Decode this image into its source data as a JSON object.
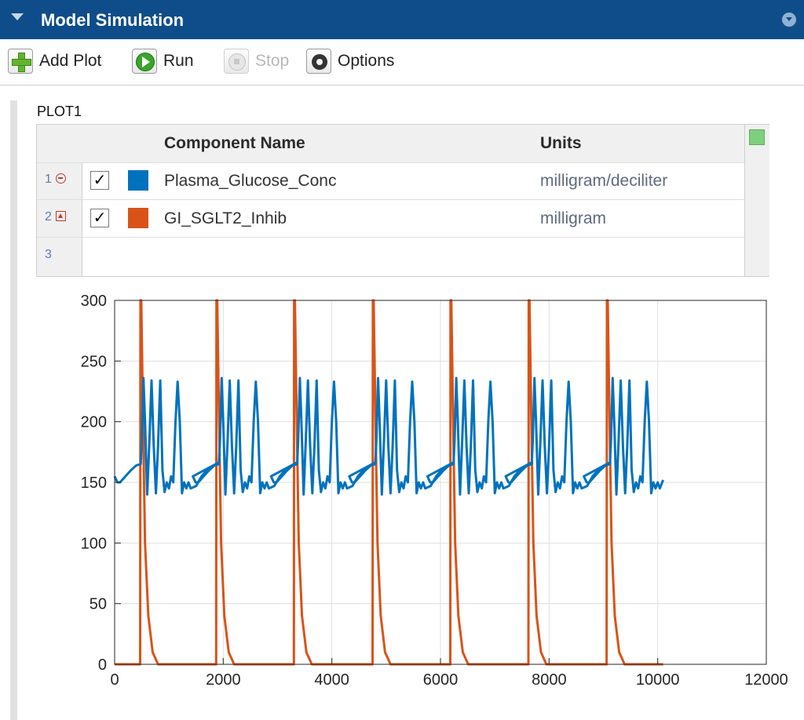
{
  "panel": {
    "title": "Model Simulation"
  },
  "toolbar": {
    "add_plot": "Add Plot",
    "run": "Run",
    "stop": "Stop",
    "options": "Options"
  },
  "plot": {
    "name": "PLOT1",
    "table": {
      "headers": {
        "component": "Component Name",
        "units": "Units"
      },
      "rows": [
        {
          "num": "1",
          "checked": true,
          "color": "#0072bd",
          "name": "Plasma_Glucose_Conc",
          "units": "milligram/deciliter"
        },
        {
          "num": "2",
          "checked": true,
          "color": "#d95319",
          "name": "GI_SGLT2_Inhib",
          "units": "milligram"
        },
        {
          "num": "3",
          "checked": false,
          "color": "",
          "name": "",
          "units": ""
        }
      ]
    }
  },
  "chart_data": {
    "type": "line",
    "xlim": [
      0,
      12000
    ],
    "ylim": [
      0,
      300
    ],
    "xticks": [
      0,
      2000,
      4000,
      6000,
      8000,
      10000,
      12000
    ],
    "yticks": [
      0,
      50,
      100,
      150,
      200,
      250,
      300
    ],
    "xtick_labels": [
      "0",
      "2000",
      "4000",
      "6000",
      "8000",
      "10000",
      "12000"
    ],
    "ytick_labels": [
      "0",
      "50",
      "100",
      "150",
      "200",
      "250",
      "300"
    ],
    "grid": true,
    "series": [
      {
        "color": "#0072bd",
        "x": [
          0,
          50,
          100,
          200,
          300,
          400,
          480,
          500,
          530,
          560,
          600,
          640,
          680,
          720,
          760,
          800,
          840,
          880,
          920,
          960,
          1000,
          1040,
          1080,
          1120,
          1160,
          1200,
          1240,
          1280,
          1320,
          1360,
          1400,
          1500,
          1600,
          1700,
          1800,
          1900
        ],
        "y": [
          155,
          150,
          150,
          155,
          160,
          164,
          165,
          185,
          236,
          200,
          140,
          185,
          234,
          180,
          141,
          180,
          234,
          160,
          142,
          150,
          145,
          155,
          150,
          200,
          233,
          200,
          141,
          150,
          145,
          150,
          145,
          147,
          155,
          160,
          163,
          166
        ]
      },
      {
        "color": "#d95319",
        "x": [
          0,
          470,
          475,
          490,
          520,
          560,
          620,
          700,
          800,
          1400,
          1870,
          1875,
          1890,
          1920,
          1960,
          2020,
          2100,
          2200,
          2800,
          3300,
          3305,
          3320,
          3350,
          3390,
          3450,
          3530,
          3630,
          4200,
          4750,
          4755,
          4770,
          4800,
          4840,
          4900,
          4980,
          5080,
          5700,
          6180,
          6185,
          6200,
          6230,
          6270,
          6330,
          6410,
          6510,
          7100,
          7620,
          7625,
          7640,
          7670,
          7710,
          7770,
          7850,
          7950,
          8500,
          9060,
          9065,
          9080,
          9110,
          9150,
          9210,
          9290,
          9390,
          10100
        ],
        "y": [
          0,
          0,
          300,
          300,
          210,
          100,
          40,
          10,
          0,
          0,
          0,
          300,
          300,
          210,
          100,
          40,
          10,
          0,
          0,
          0,
          300,
          300,
          210,
          100,
          40,
          10,
          0,
          0,
          0,
          300,
          300,
          210,
          100,
          40,
          10,
          0,
          0,
          0,
          300,
          300,
          210,
          100,
          40,
          10,
          0,
          0,
          0,
          300,
          300,
          210,
          100,
          40,
          10,
          0,
          0,
          0,
          300,
          300,
          210,
          100,
          40,
          10,
          0,
          0
        ]
      }
    ]
  }
}
